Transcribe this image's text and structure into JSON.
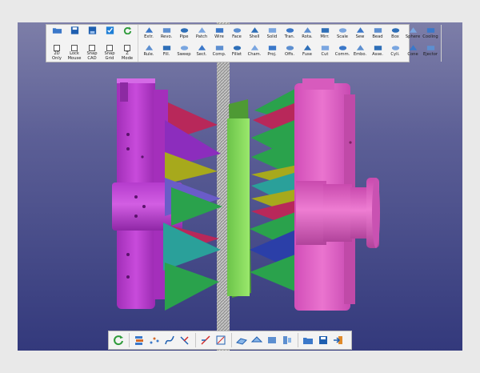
{
  "toolbar": {
    "file_tools": [
      "open-folder-icon",
      "save-icon",
      "save-as-icon",
      "check-icon",
      "refresh-icon"
    ],
    "toggles": [
      {
        "label1": "2D",
        "label2": "Only",
        "checked": false
      },
      {
        "label1": "Lock",
        "label2": "Mouse",
        "checked": false
      },
      {
        "label1": "Snap",
        "label2": "CAD",
        "checked": false
      },
      {
        "label1": "Snap",
        "label2": "Grid",
        "checked": false
      },
      {
        "label1": "Z",
        "label2": "Mode",
        "checked": false
      }
    ],
    "solid_tools_top": [
      "Extr.",
      "Revo.",
      "Pipe",
      "Patch",
      "Wire",
      "Face",
      "Shell",
      "Solid",
      "Tran.",
      "Rota.",
      "Mirr.",
      "Scale",
      "Sew",
      "Bead",
      "Box",
      "Sphere",
      "Cooling"
    ],
    "solid_tools_bottom": [
      "Rule.",
      "Fill.",
      "Sweep",
      "Sect.",
      "Comp.",
      "Fillet",
      "Cham.",
      "Proj.",
      "Offs.",
      "Fuse",
      "Cut",
      "Comm.",
      "Embo.",
      "Asse.",
      "Cyli.",
      "Cone",
      "Ejector"
    ]
  },
  "bottombar": {
    "tools": [
      "refresh-icon",
      "layers-icon",
      "points-icon",
      "curve-icon",
      "trim-icon",
      "extend-icon",
      "measure-icon",
      "surface-icon",
      "mesh-icon",
      "solid-icon",
      "assembly-icon",
      "open-folder-icon",
      "save-icon",
      "exit-icon"
    ]
  },
  "colors": {
    "background_top": "#7d7ea8",
    "background_bottom": "#33397c",
    "magenta_part": "#c23fd4",
    "pink_part": "#e466c8",
    "green_plate": "#8ee061",
    "cone_green": "#2aa24c",
    "cone_teal": "#2aa09a",
    "cone_blue": "#2b3fa8",
    "cone_crimson": "#b8285a",
    "cone_olive": "#a7a91c"
  }
}
